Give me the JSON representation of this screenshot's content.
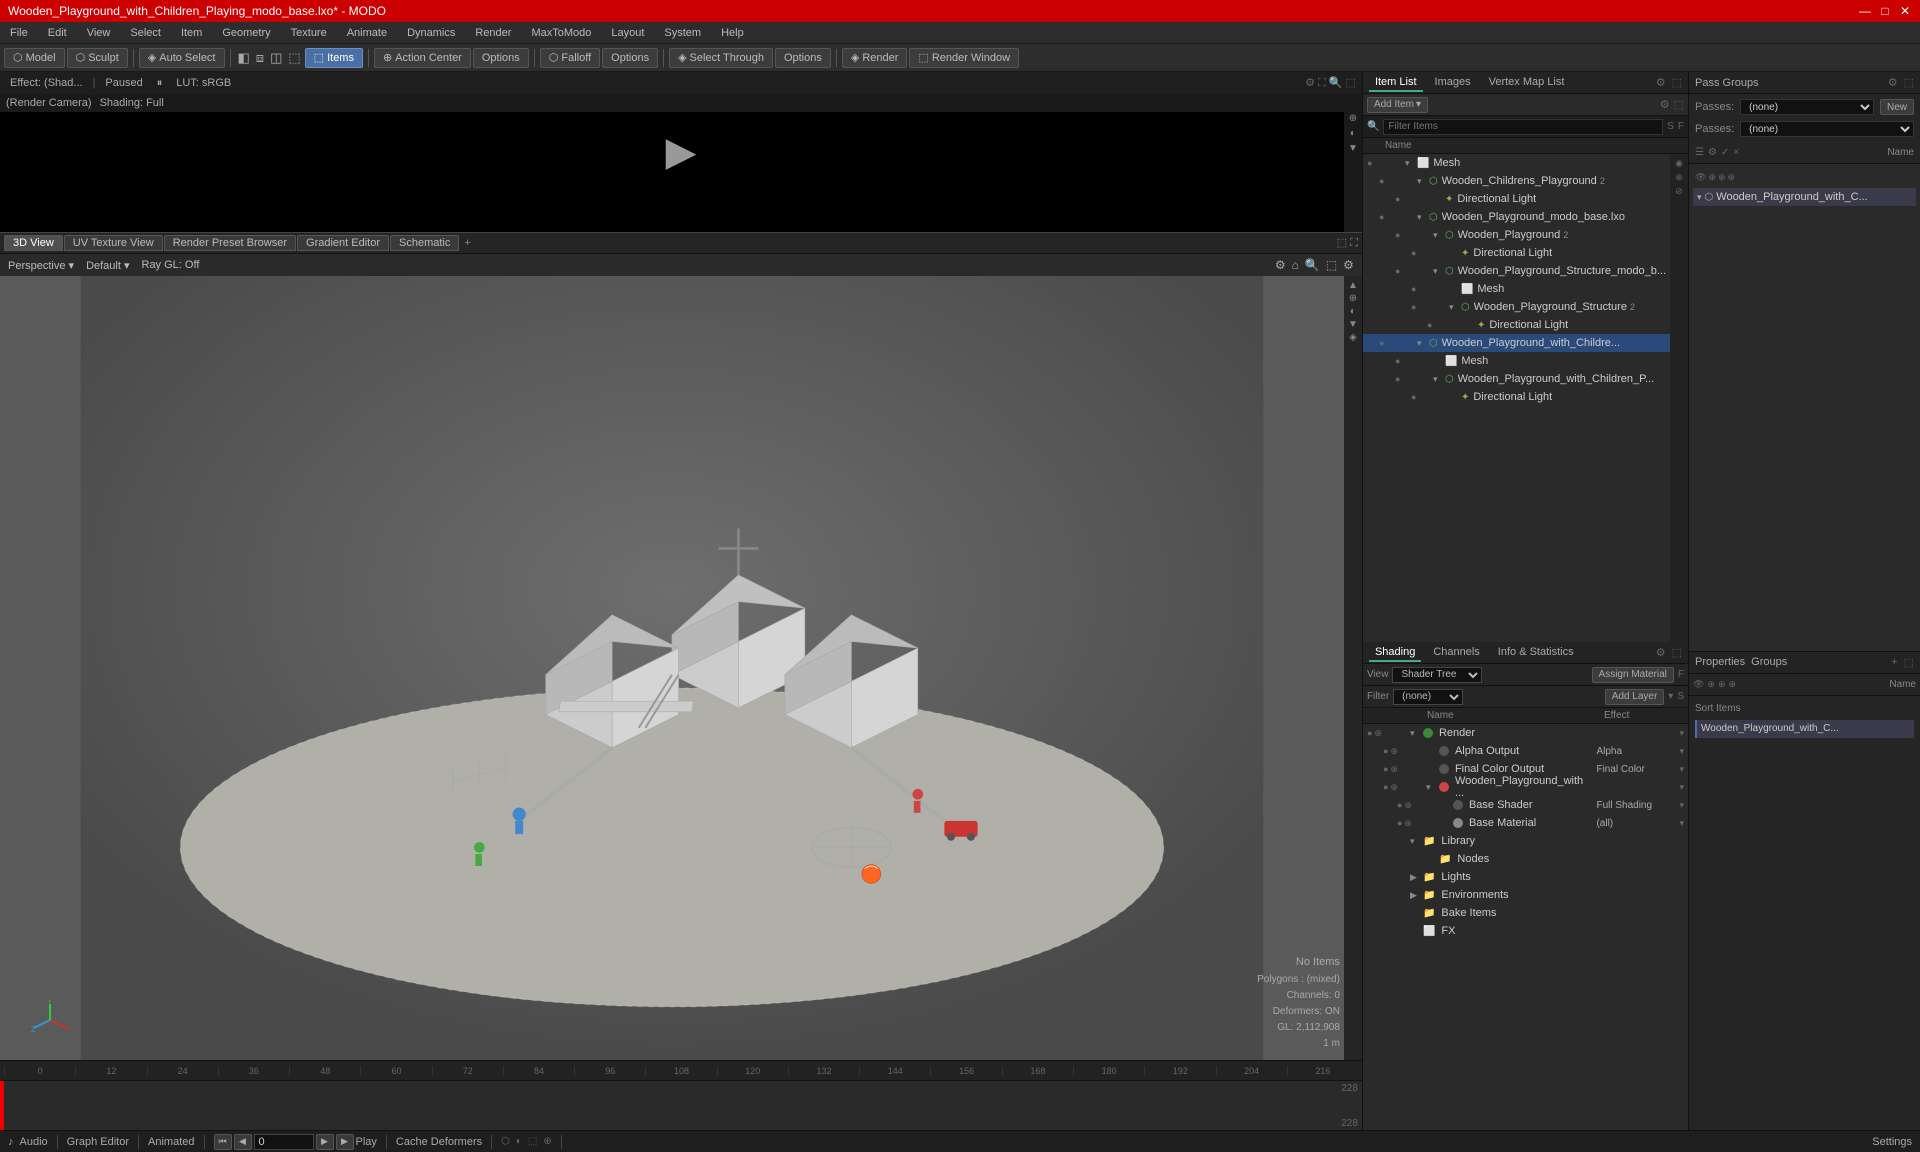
{
  "titlebar": {
    "title": "Wooden_Playground_with_Children_Playing_modo_base.lxo* - MODO",
    "minimize": "—",
    "maximize": "□",
    "close": "✕"
  },
  "menubar": {
    "items": [
      "File",
      "Edit",
      "View",
      "Select",
      "Item",
      "Geometry",
      "Texture",
      "Animate",
      "Dynamics",
      "Render",
      "MaxToModo",
      "Layout",
      "System",
      "Help"
    ]
  },
  "toolbar": {
    "model_btn": "Model",
    "sculpt_btn": "Sculpt",
    "auto_select": "Auto Select",
    "items_btn": "Items",
    "action_center": "Action Center",
    "options1": "Options",
    "falloff": "Falloff",
    "options2": "Options",
    "select_through": "Select Through",
    "options3": "Options",
    "render": "Render",
    "render_window": "Render Window"
  },
  "preview": {
    "effect_label": "Effect: (Shad...",
    "paused": "Paused",
    "lut": "LUT: sRGB",
    "render_camera": "(Render Camera)",
    "shading": "Shading: Full"
  },
  "viewport": {
    "tabs": [
      "3D View",
      "UV Texture View",
      "Render Preset Browser",
      "Gradient Editor",
      "Schematic"
    ],
    "mode": "Perspective",
    "default": "Default",
    "ray_gl": "Ray GL: Off"
  },
  "scene_info": {
    "no_items": "No Items",
    "polygons": "Polygons : (mixed)",
    "channels": "Channels: 0",
    "deformers": "Deformers: ON",
    "gl_info": "GL: 2,112,908",
    "scale": "1 m"
  },
  "timeline": {
    "ruler_marks": [
      "0",
      "12",
      "24",
      "36",
      "48",
      "60",
      "72",
      "84",
      "96",
      "108",
      "120",
      "132",
      "144",
      "156",
      "168",
      "180",
      "192",
      "204",
      "216"
    ],
    "end_mark": "228",
    "end_mark2": "228"
  },
  "bottombar": {
    "audio_icon": "♪",
    "audio_label": "Audio",
    "graph_editor": "Graph Editor",
    "animated": "Animated",
    "play": "Play",
    "cache_deformers": "Cache Deformers",
    "settings": "Settings",
    "timecode": "0"
  },
  "item_list": {
    "panel_tabs": [
      "Item List",
      "Images",
      "Vertex Map List"
    ],
    "add_item": "Add Item",
    "filter_placeholder": "Filter Items",
    "col_name": "Name",
    "items": [
      {
        "id": 1,
        "level": 0,
        "expanded": true,
        "label": "Mesh",
        "icon": "mesh",
        "vis": true
      },
      {
        "id": 2,
        "level": 1,
        "expanded": true,
        "label": "Wooden_Childrens_Playground",
        "num": "2",
        "icon": "scene",
        "vis": true
      },
      {
        "id": 3,
        "level": 2,
        "expanded": false,
        "label": "Directional Light",
        "icon": "light",
        "vis": true
      },
      {
        "id": 4,
        "level": 1,
        "expanded": true,
        "label": "Wooden_Playground_modo_base.lxo",
        "icon": "scene",
        "vis": true
      },
      {
        "id": 5,
        "level": 2,
        "expanded": true,
        "label": "Wooden_Playground",
        "num": "2",
        "icon": "scene",
        "vis": true
      },
      {
        "id": 6,
        "level": 3,
        "expanded": false,
        "label": "Directional Light",
        "icon": "light",
        "vis": true
      },
      {
        "id": 7,
        "level": 2,
        "expanded": true,
        "label": "Wooden_Playground_Structure_modo_b...",
        "icon": "scene",
        "vis": true
      },
      {
        "id": 8,
        "level": 3,
        "expanded": false,
        "label": "Mesh",
        "icon": "mesh",
        "vis": true
      },
      {
        "id": 9,
        "level": 3,
        "expanded": true,
        "label": "Wooden_Playground_Structure",
        "num": "2",
        "icon": "scene",
        "vis": true
      },
      {
        "id": 10,
        "level": 4,
        "expanded": false,
        "label": "Directional Light",
        "icon": "light",
        "vis": true
      },
      {
        "id": 11,
        "level": 1,
        "expanded": true,
        "label": "Wooden_Playground_with_Childre...",
        "icon": "scene",
        "vis": true,
        "selected": true
      },
      {
        "id": 12,
        "level": 2,
        "expanded": false,
        "label": "Mesh",
        "icon": "mesh",
        "vis": true
      },
      {
        "id": 13,
        "level": 2,
        "expanded": true,
        "label": "Wooden_Playground_with_Children_P...",
        "icon": "scene",
        "vis": true
      },
      {
        "id": 14,
        "level": 3,
        "expanded": false,
        "label": "Directional Light",
        "icon": "light",
        "vis": true
      }
    ]
  },
  "groups": {
    "title": "Pass Groups",
    "passes_label": "Passes:",
    "passes_value": "(none)",
    "new_label": "New",
    "passes_label2": "Passes:",
    "passes_value2": "(none)",
    "toolbar_icons": [
      "☰",
      "⚙",
      "✓",
      "×"
    ],
    "name_col": "Name",
    "group_item": "Wooden_Playground_with_C..."
  },
  "shading": {
    "panel_tabs": [
      "Shading",
      "Channels",
      "Info & Statistics"
    ],
    "view_label": "View",
    "view_value": "Shader Tree",
    "assign_material": "Assign Material",
    "filter_label": "Filter",
    "filter_value": "(none)",
    "add_layer": "Add Layer",
    "col_name": "Name",
    "col_effect": "Effect",
    "items": [
      {
        "id": 1,
        "level": 0,
        "label": "Render",
        "effect": "",
        "color": "#444",
        "expanded": true,
        "type": "render"
      },
      {
        "id": 2,
        "level": 1,
        "label": "Alpha Output",
        "effect": "Alpha",
        "color": "#555",
        "type": "output"
      },
      {
        "id": 3,
        "level": 1,
        "label": "Final Color Output",
        "effect": "Final Color",
        "color": "#555",
        "type": "output"
      },
      {
        "id": 4,
        "level": 1,
        "label": "Wooden_Playground_with ...",
        "effect": "",
        "color": "#c44",
        "expanded": true,
        "type": "material"
      },
      {
        "id": 5,
        "level": 2,
        "label": "Base Shader",
        "effect": "Full Shading",
        "color": "#555",
        "type": "shader"
      },
      {
        "id": 6,
        "level": 2,
        "label": "Base Material",
        "effect": "(all)",
        "color": "#555",
        "type": "material"
      },
      {
        "id": 7,
        "level": 0,
        "label": "Library",
        "effect": "",
        "color": "#444",
        "expanded": true,
        "type": "folder"
      },
      {
        "id": 8,
        "level": 1,
        "label": "Nodes",
        "effect": "",
        "color": "#444",
        "type": "folder"
      },
      {
        "id": 9,
        "level": 0,
        "label": "Lights",
        "effect": "",
        "color": "#444",
        "expanded": false,
        "type": "folder"
      },
      {
        "id": 10,
        "level": 0,
        "label": "Environments",
        "effect": "",
        "color": "#444",
        "expanded": false,
        "type": "folder"
      },
      {
        "id": 11,
        "level": 0,
        "label": "Bake Items",
        "effect": "",
        "color": "#444",
        "expanded": false,
        "type": "folder"
      },
      {
        "id": 12,
        "level": 0,
        "label": "FX",
        "effect": "",
        "color": "#444",
        "expanded": false,
        "type": "folder"
      }
    ]
  }
}
